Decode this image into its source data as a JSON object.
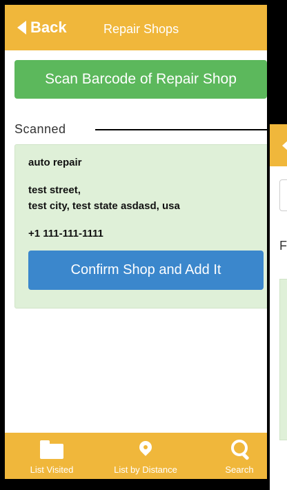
{
  "header": {
    "back_label": "Back",
    "title": "Repair Shops"
  },
  "scan_button": "Scan Barcode of Repair Shop",
  "scanned_section": {
    "label": "Scanned",
    "shop": {
      "name": "auto repair",
      "address_line1": "test street,",
      "address_line2": "test city, test state asdasd, usa",
      "phone": "+1 111-111-1111"
    },
    "confirm_button": "Confirm Shop and Add It"
  },
  "footer": {
    "tabs": [
      {
        "label": "List Visited",
        "icon": "folder-icon"
      },
      {
        "label": "List by Distance",
        "icon": "map-pin-icon"
      },
      {
        "label": "Search",
        "icon": "search-icon"
      }
    ]
  },
  "overlay_screen": {
    "partial_label": "F"
  },
  "colors": {
    "header_bg": "#f0b73b",
    "scan_button_bg": "#5cb85c",
    "card_bg": "#dff0d8",
    "confirm_button_bg": "#3b87cc"
  }
}
